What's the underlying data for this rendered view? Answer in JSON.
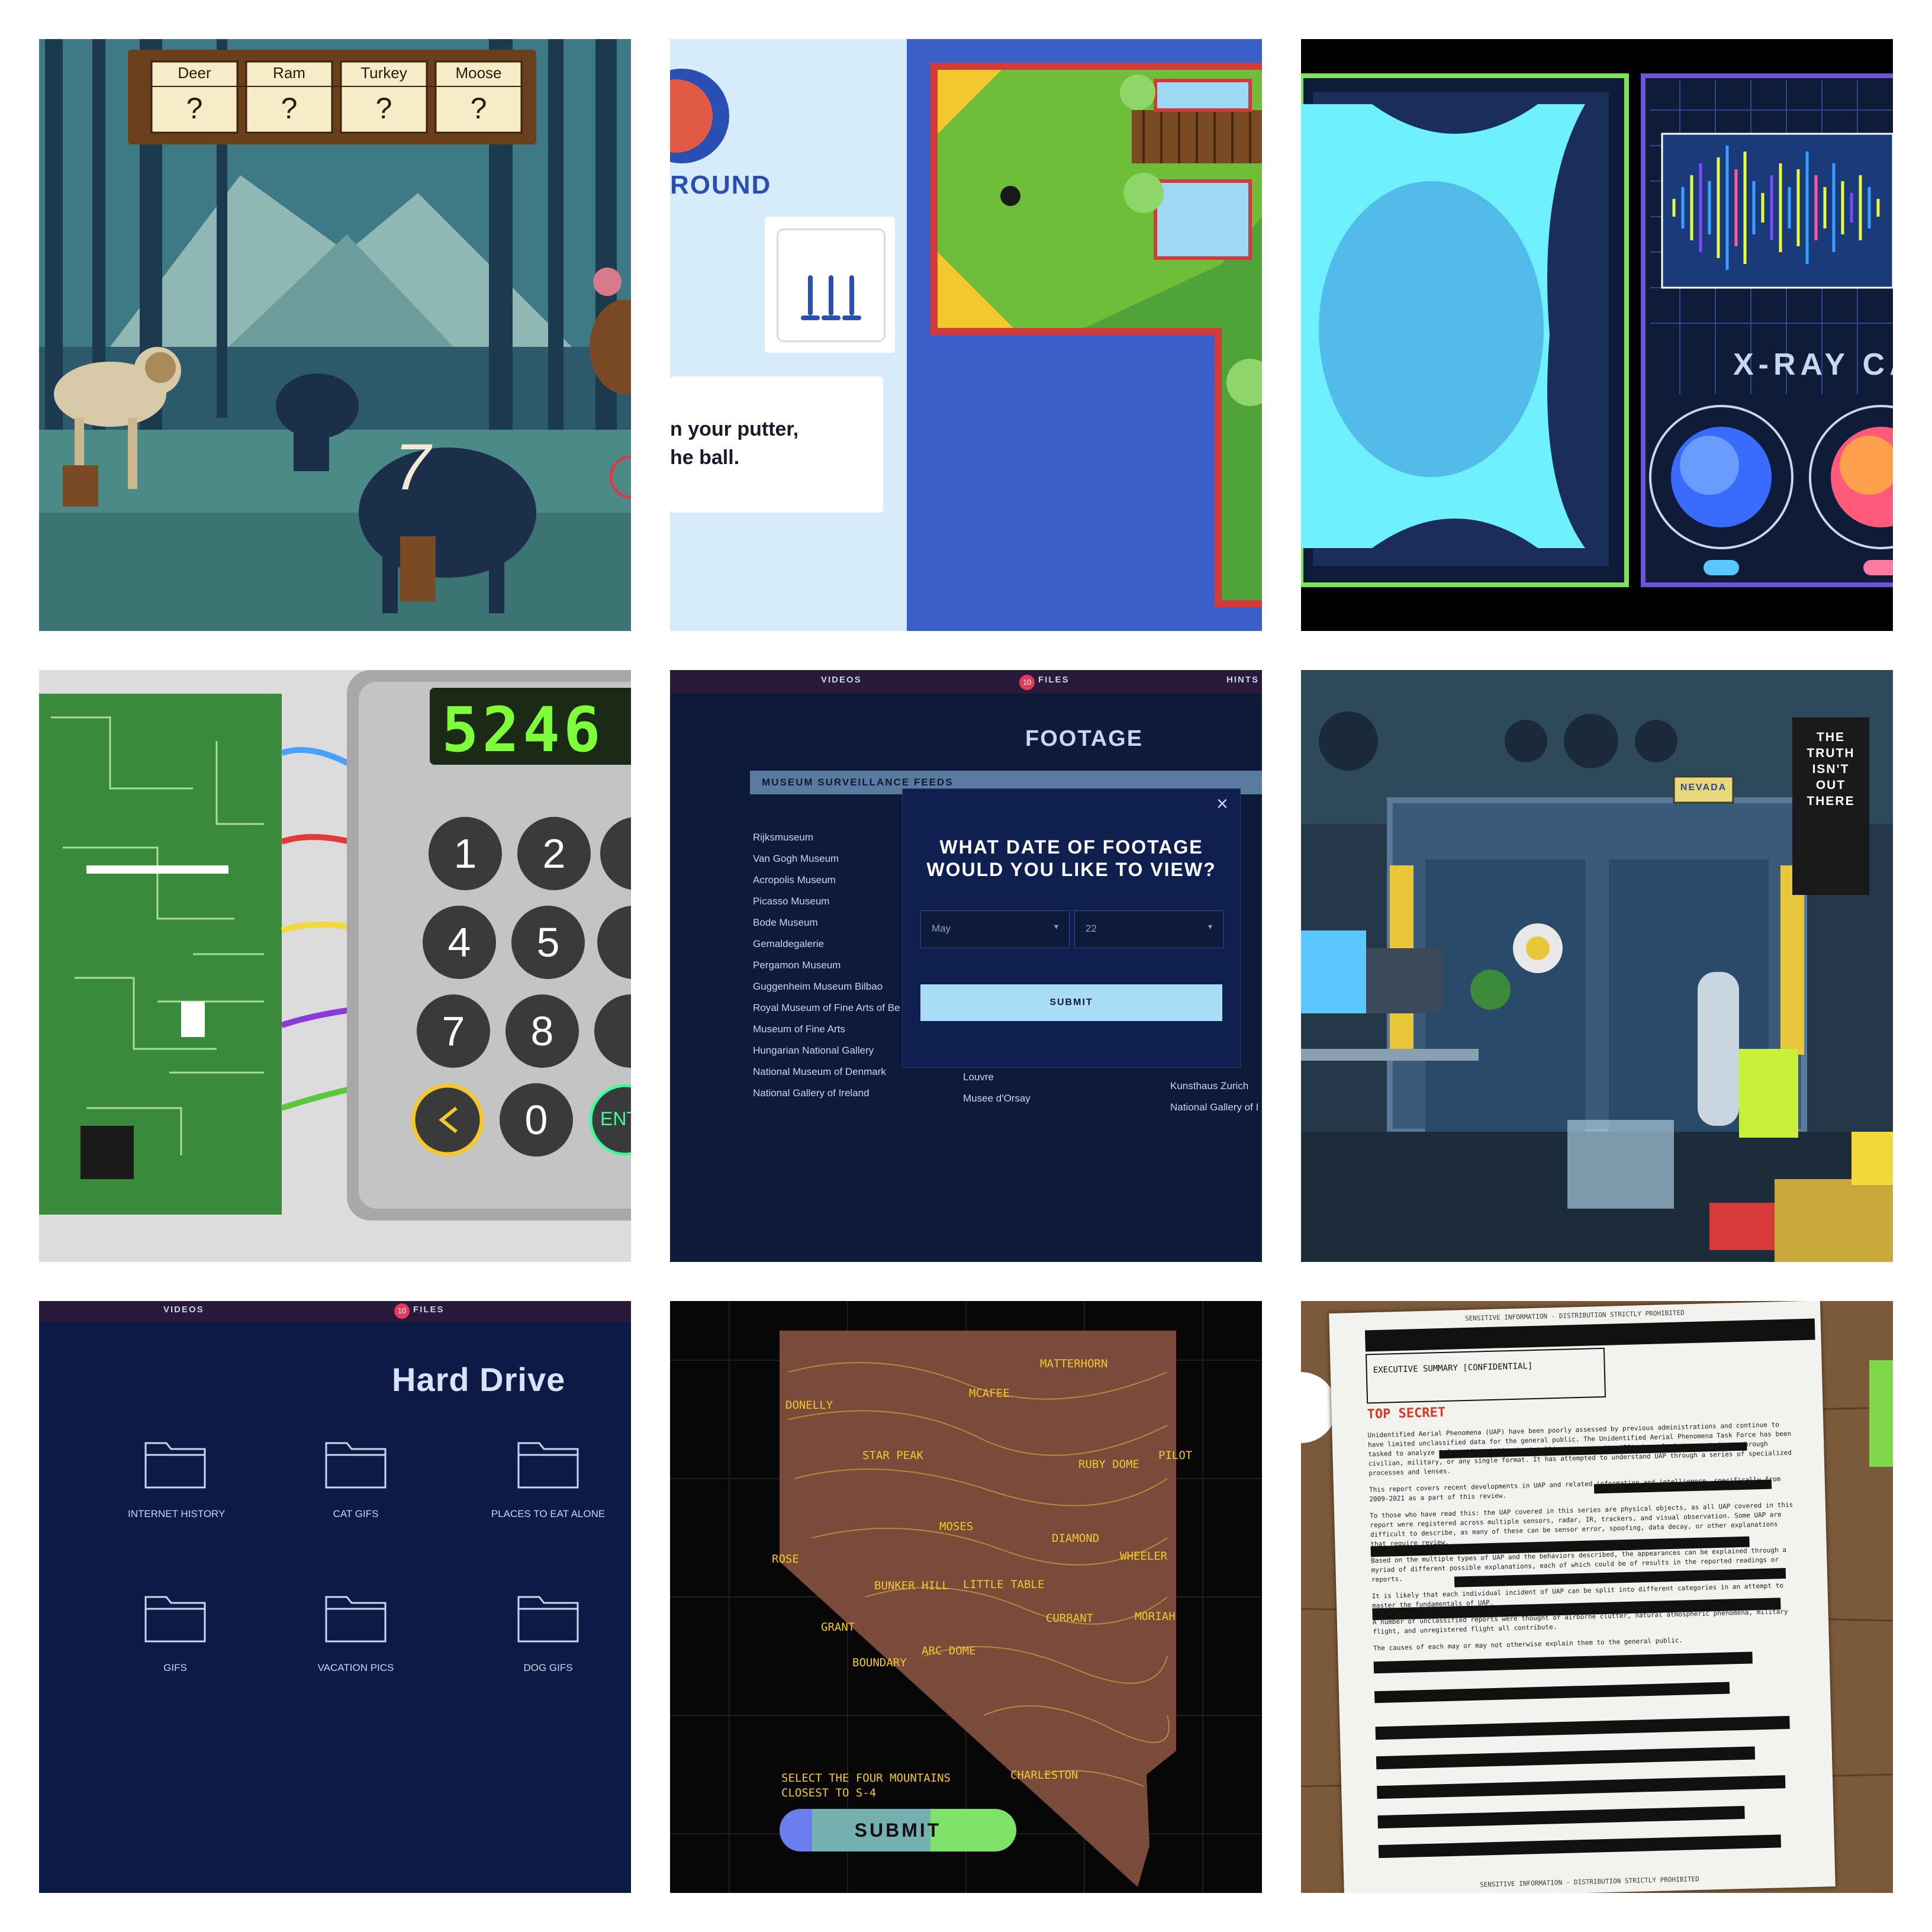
{
  "hunt": {
    "labels": [
      {
        "name": "Deer",
        "value": "?"
      },
      {
        "name": "Ram",
        "value": "?"
      },
      {
        "name": "Turkey",
        "value": "?"
      },
      {
        "name": "Moose",
        "value": "?"
      }
    ],
    "moose_number": "7"
  },
  "golf": {
    "title_fragment": "ROUND",
    "instruction_line1": "n your putter,",
    "instruction_line2": "he ball."
  },
  "xray": {
    "title_fragment": "X-RAY CALIB"
  },
  "keypad": {
    "display": "5246",
    "keys": [
      "1",
      "2",
      "4",
      "5",
      "7",
      "8",
      "0"
    ],
    "enter_fragment": "ENT"
  },
  "footage": {
    "nav": {
      "videos": "VIDEOS",
      "files_count": "10",
      "files": "FILES",
      "hints": "HINTS"
    },
    "title": "FOOTAGE",
    "feeds_header": "MUSEUM SURVEILLANCE FEEDS",
    "museums": [
      "Rijksmuseum",
      "Van Gogh Museum",
      "Acropolis Museum",
      "Picasso Museum",
      "Bode Museum",
      "Gemaldegalerie",
      "Pergamon Museum",
      "Guggenheim Museum Bilbao",
      "Royal Museum of Fine Arts of Be",
      "Museum of Fine Arts",
      "Hungarian National Gallery",
      "National Museum of Denmark",
      "National Gallery of Ireland"
    ],
    "museums_col2": [
      "Louvre",
      "Musee d'Orsay"
    ],
    "museums_col3": [
      "Kunsthaus Zurich",
      "National Gallery of I"
    ],
    "modal_question_line1": "WHAT DATE OF FOOTAGE",
    "modal_question_line2": "WOULD YOU LIKE TO VIEW?",
    "month_value": "May",
    "day_value": "22",
    "submit_label": "SUBMIT"
  },
  "bunker": {
    "sign_lines": [
      "THE",
      "TRUTH",
      "ISN'T",
      "OUT",
      "THERE"
    ],
    "plate_text": "NEVADA"
  },
  "harddrive": {
    "nav": {
      "videos": "VIDEOS",
      "files_count": "10",
      "files": "FILES"
    },
    "title": "Hard Drive",
    "folders": [
      "INTERNET HISTORY",
      "CAT GIFS",
      "PLACES TO EAT ALONE",
      "GIFS",
      "VACATION PICS",
      "DOG GIFS"
    ]
  },
  "map": {
    "peaks": [
      "MATTERHORN",
      "DONELLY",
      "MCAFEE",
      "STAR PEAK",
      "RUBY DOME",
      "PILOT",
      "MOSES",
      "DIAMOND",
      "ROSE",
      "WHEELER",
      "BUNKER HILL",
      "LITTLE TABLE",
      "CURRANT",
      "MORIAH",
      "GRANT",
      "ARC DOME",
      "BOUNDARY",
      "CHARLESTON"
    ],
    "prompt_line1": "SELECT THE FOUR MOUNTAINS",
    "prompt_line2": "CLOSEST TO S-4",
    "submit_label": "SUBMIT"
  },
  "document": {
    "header": "SENSITIVE INFORMATION - DISTRIBUTION STRICTLY PROHIBITED",
    "summary_title": "EXECUTIVE SUMMARY [CONFIDENTIAL]",
    "stamp": "TOP SECRET",
    "para1": "Unidentified Aerial Phenomena (UAP) have been poorly assessed by previous administrations and continue to have limited unclassified data for the general public. The Unidentified Aerial Phenomena Task Force has been tasked to analyze information within the intelligence community (IC) channels but cannot do so through civilian, military, or any single format. It has attempted to understand UAP through a series of specialized processes and lenses.",
    "para2": "This report covers recent developments in UAP and related information and intelligence, specifically from 2009-2021 as a part of this review.",
    "para3": "To those who have read this: the UAP covered in this series are physical objects, as all UAP covered in this report were registered across multiple sensors, radar, IR, trackers, and visual observation. Some UAP are difficult to describe, as many of these can be sensor error, spoofing, data decay, or other explanations that require review.",
    "para4": "Based on the multiple types of UAP and the behaviors described, the appearances can be explained through a myriad of different possible explanations, each of which could be of results in the reported readings or reports.",
    "para5": "It is likely that each individual incident of UAP can be split into different categories in an attempt to master the fundamentals of UAP.",
    "para6": "A number of unclassified reports were thought of airborne clutter, natural atmospheric phenomena, military flight, and unregistered flight all contribute.",
    "para7": "The causes of each may or may not otherwise explain them to the general public.",
    "footer": "SENSITIVE INFORMATION - DISTRIBUTION STRICTLY PROHIBITED"
  },
  "colors": {
    "footage_bg": "#0d1a3a",
    "submit_blue": "#a9dcf5",
    "keypad_green": "#7dff3a",
    "map_bg": "#070707",
    "xray_cyan": "#6ff0ff",
    "grass": "#6fbe3a"
  }
}
